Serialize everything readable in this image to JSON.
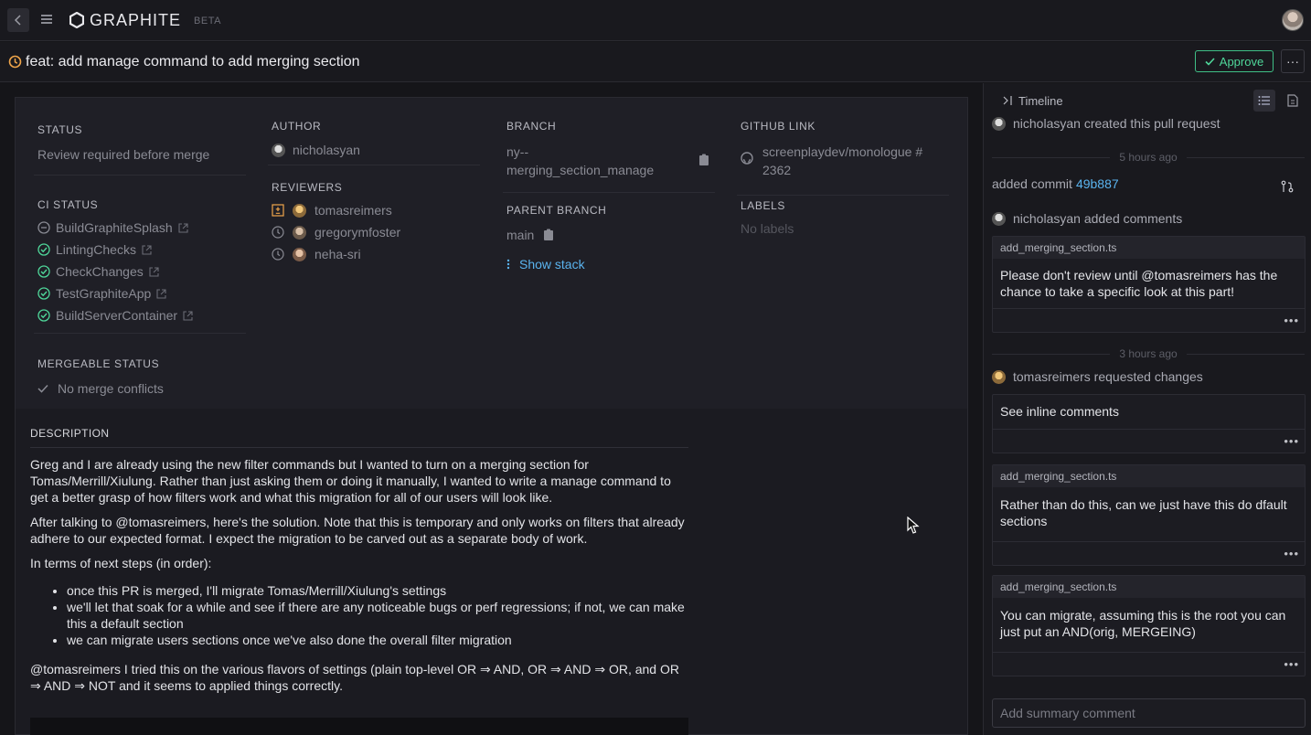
{
  "topbar": {
    "logo": "GRAPHITE",
    "beta": "BETA"
  },
  "pr": {
    "title": "feat: add manage command to add merging section",
    "approve_label": "Approve",
    "more_label": "···"
  },
  "status": {
    "label": "STATUS",
    "value": "Review required before merge",
    "ci_label": "CI STATUS",
    "checks": [
      {
        "name": "BuildGraphiteSplash",
        "state": "skipped"
      },
      {
        "name": "LintingChecks",
        "state": "passed"
      },
      {
        "name": "CheckChanges",
        "state": "passed"
      },
      {
        "name": "TestGraphiteApp",
        "state": "passed"
      },
      {
        "name": "BuildServerContainer",
        "state": "passed"
      }
    ],
    "mergeable_label": "MERGEABLE STATUS",
    "mergeable_value": "No merge conflicts"
  },
  "author": {
    "label": "AUTHOR",
    "name": "nicholasyan",
    "reviewers_label": "REVIEWERS",
    "reviewers": [
      {
        "name": "tomasreimers",
        "state": "changes-requested"
      },
      {
        "name": "gregorymfoster",
        "state": "pending"
      },
      {
        "name": "neha-sri",
        "state": "pending"
      }
    ]
  },
  "branch": {
    "label": "BRANCH",
    "name_line1": "ny--",
    "name_line2": "merging_section_manage",
    "parent_label": "PARENT BRANCH",
    "parent": "main",
    "show_stack": "Show stack"
  },
  "github": {
    "label": "GITHUB LINK",
    "link_line1": "screenplaydev/monologue #",
    "link_line2": "2362",
    "labels_label": "LABELS",
    "labels_value": "No labels"
  },
  "description": {
    "title": "DESCRIPTION",
    "p1": "Greg and I are already using the new filter commands but I wanted to turn on a merging section for Tomas/Merrill/Xiulung. Rather than just asking them or doing it manually, I wanted to write a manage command to get a better grasp of how filters work and what this migration for all of our users will look like.",
    "p2": "After talking to @tomasreimers, here's the solution. Note that this is temporary and only works on filters that already adhere to our expected format. I expect the migration to be carved out as a separate body of work.",
    "p3": "In terms of next steps (in order):",
    "steps": [
      "once this PR is merged, I'll migrate Tomas/Merrill/Xiulung's settings",
      "we'll let that soak for a while and see if there are any noticeable bugs or perf regressions; if not, we can make this a default section",
      "we can migrate users sections once we've also done the overall filter migration"
    ],
    "p4": "@tomasreimers I tried this on the various flavors of settings (plain top-level OR ⇒ AND, OR ⇒ AND ⇒ OR, and OR ⇒ AND ⇒ NOT and it seems to applied things correctly."
  },
  "timeline": {
    "label": "Timeline",
    "created": "nicholasyan created this pull request",
    "sep1": "5 hours ago",
    "commit_text": "added commit",
    "commit_hash": "49b887",
    "comment_event": "nicholasyan added comments",
    "comments": [
      {
        "file": "add_merging_section.ts",
        "body": "Please don't review until @tomasreimers has the chance to take a specific look at this part!"
      }
    ],
    "sep2": "3 hours ago",
    "review_event": "tomasreimers requested changes",
    "review_body": "See inline comments",
    "review_comments": [
      {
        "file": "add_merging_section.ts",
        "body": "Rather than do this, can we just have this do dfault sections"
      },
      {
        "file": "add_merging_section.ts",
        "body": "You can migrate, assuming this is the root you can just put an AND(orig, MERGEING)"
      }
    ],
    "dots": "•••",
    "summary_placeholder": "Add summary comment"
  },
  "colors": {
    "accent_green": "#4fd79a",
    "link_blue": "#5ab3ee",
    "warning_orange": "#f0a54a"
  }
}
